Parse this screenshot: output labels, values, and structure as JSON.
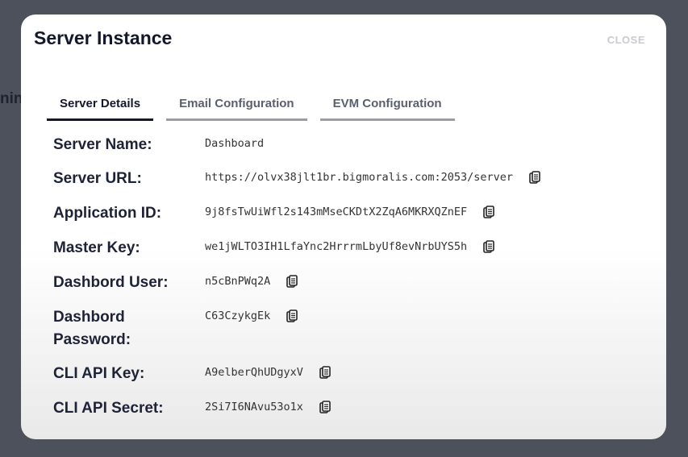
{
  "background": {
    "partial_text": "nin"
  },
  "modal": {
    "title": "Server Instance",
    "close_label": "CLOSE",
    "tabs": [
      {
        "label": "Server Details",
        "active": true
      },
      {
        "label": "Email Configuration",
        "active": false
      },
      {
        "label": "EVM Configuration",
        "active": false
      }
    ],
    "fields": [
      {
        "label": "Server Name:",
        "value": "Dashboard",
        "copy": false
      },
      {
        "label": "Server URL:",
        "value": "https://olvx38jlt1br.bigmoralis.com:2053/server",
        "copy": true
      },
      {
        "label": "Application ID:",
        "value": "9j8fsTwUiWfl2s143mMseCKDtX2ZqA6MKRXQZnEF",
        "copy": true
      },
      {
        "label": "Master Key:",
        "value": "we1jWLTO3IH1LfaYnc2HrrrmLbyUf8evNrbUYS5h",
        "copy": true
      },
      {
        "label": "Dashbord User:",
        "value": "n5cBnPWq2A",
        "copy": true
      },
      {
        "label": "Dashbord Password:",
        "value": "C63CzykgEk",
        "copy": true
      },
      {
        "label": "CLI API Key:",
        "value": "A9elberQhUDgyxV",
        "copy": true
      },
      {
        "label": "CLI API Secret:",
        "value": "2Si7I6NAvu53o1x",
        "copy": true
      }
    ]
  }
}
